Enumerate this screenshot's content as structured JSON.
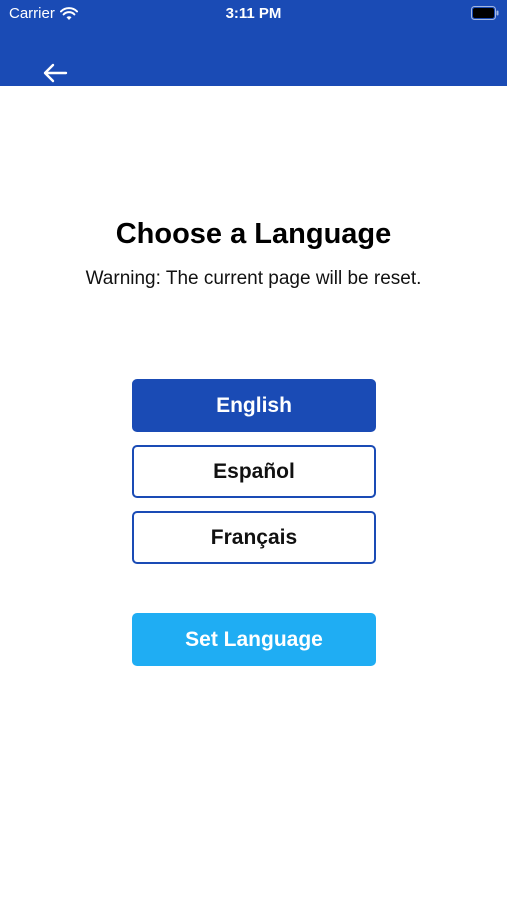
{
  "status_bar": {
    "carrier": "Carrier",
    "time": "3:11 PM"
  },
  "header": {
    "back_icon": "arrow-left-icon",
    "color": "#1a4bb5"
  },
  "main": {
    "title": "Choose a Language",
    "warning": "Warning: The current page will be reset.",
    "languages": [
      {
        "label": "English",
        "selected": true
      },
      {
        "label": "Español",
        "selected": false
      },
      {
        "label": "Français",
        "selected": false
      }
    ],
    "set_button_label": "Set Language",
    "set_button_color": "#1fadf3"
  }
}
